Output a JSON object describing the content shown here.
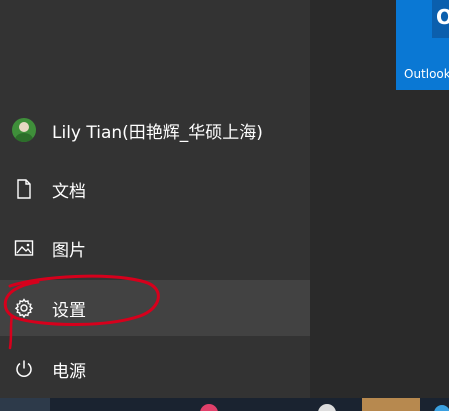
{
  "start_menu": {
    "user": {
      "name": "Lily Tian(田艳辉_华硕上海)"
    },
    "items": [
      {
        "label": "文档",
        "icon": "document-icon"
      },
      {
        "label": "图片",
        "icon": "picture-icon"
      },
      {
        "label": "设置",
        "icon": "gear-icon",
        "active": true
      },
      {
        "label": "电源",
        "icon": "power-icon"
      }
    ]
  },
  "tiles": {
    "outlook": {
      "label": "Outlook",
      "logo": "O",
      "color": "#0a78d4"
    }
  },
  "annotation": {
    "color": "#d6001c"
  },
  "colors": {
    "menu_bg": "#333333",
    "active_bg": "#424242",
    "taskbar_bg": "#1a2330"
  }
}
